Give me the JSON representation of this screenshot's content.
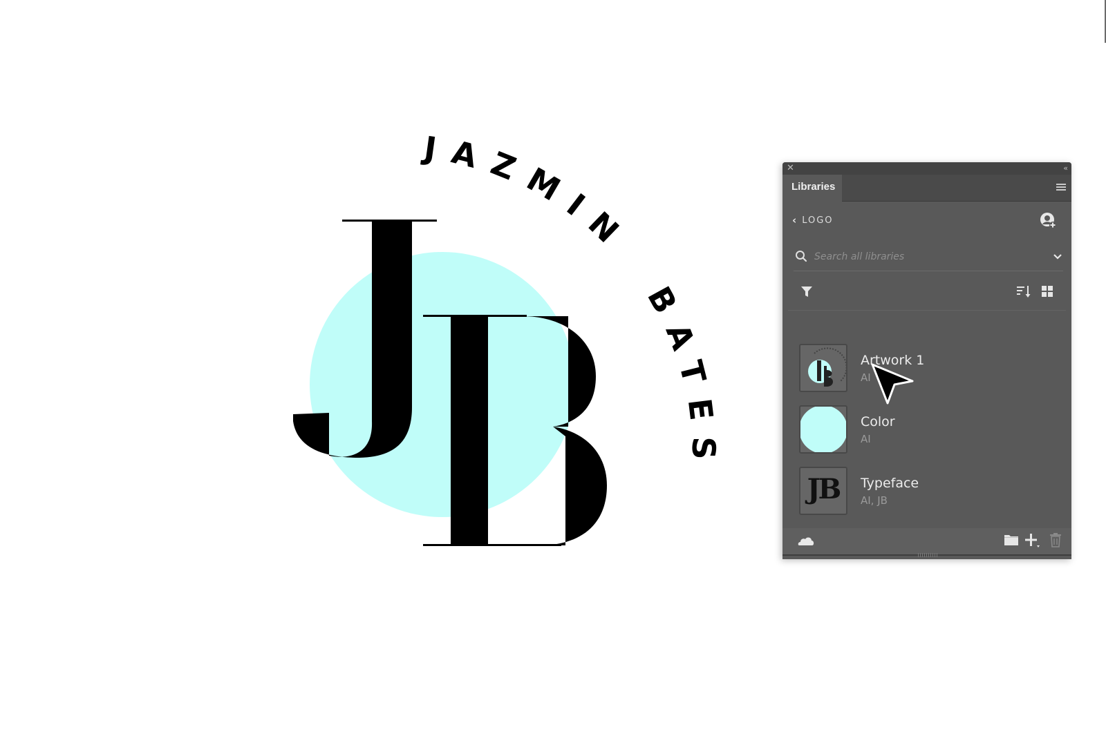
{
  "artwork": {
    "name_top": "JAZMIN",
    "name_side": "BATES",
    "monogram": "JB",
    "circle_color": "#c0fdf9",
    "ink_color": "#000000"
  },
  "panel": {
    "tab_label": "Libraries",
    "back_label": "LOGO",
    "search_placeholder": "Search all libraries",
    "search_value": "",
    "items": [
      {
        "name": "Artwork 1",
        "meta": "AI",
        "thumb": "artwork-thumbnail"
      },
      {
        "name": "Color",
        "meta": "AI",
        "thumb": "color-swatch",
        "swatch": "#c0fdf9"
      },
      {
        "name": "Typeface",
        "meta": "AI, JB",
        "thumb": "typeface-thumbnail",
        "thumb_text": "JB"
      }
    ],
    "icons": {
      "close": "close-icon",
      "collapse": "collapse-icon",
      "menu": "hamburger-menu-icon",
      "back": "chevron-left-icon",
      "collaborator": "add-user-icon",
      "search": "search-icon",
      "dropdown": "chevron-down-icon",
      "filter": "filter-icon",
      "sort": "sort-icon",
      "view": "grid-view-icon",
      "sync": "cloud-icon",
      "group": "folder-icon",
      "add": "plus-icon",
      "delete": "trash-icon"
    },
    "glyphs": {
      "close": "✕",
      "collapse": "‹‹",
      "back": "‹"
    }
  }
}
